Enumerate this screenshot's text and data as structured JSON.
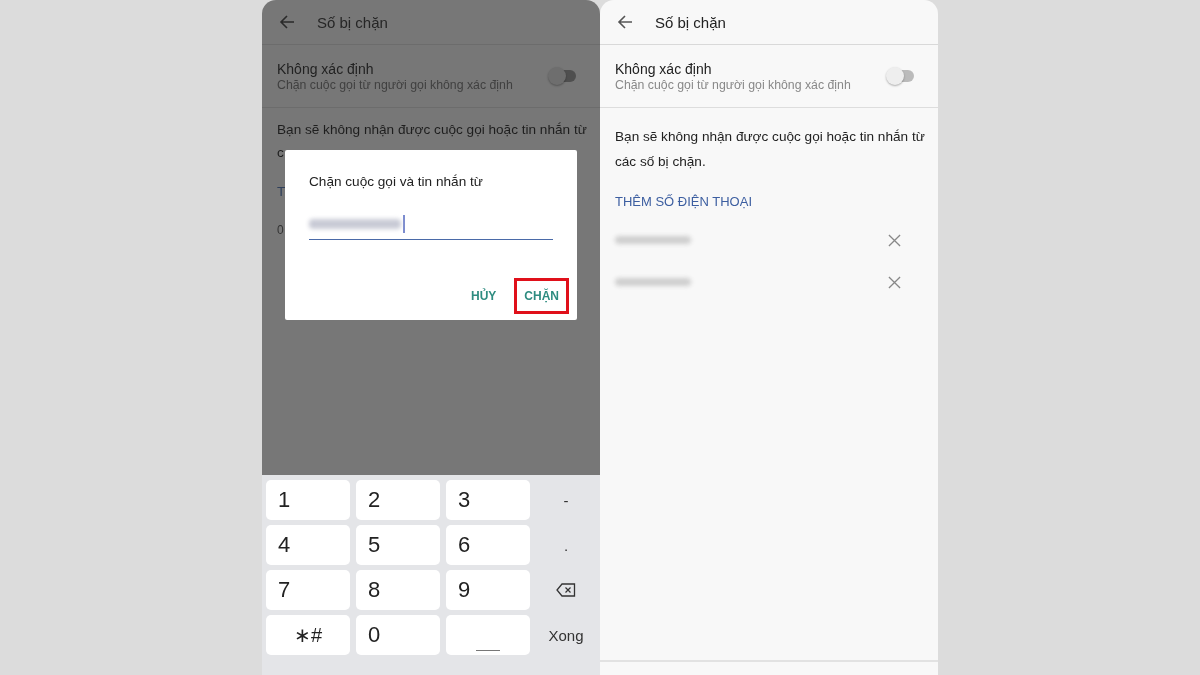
{
  "left_screen": {
    "header": {
      "title": "Số bị chặn"
    },
    "unknown_toggle": {
      "title": "Không xác định",
      "subtitle": "Chặn cuộc gọi từ người gọi không xác định",
      "on": false
    },
    "visible_fragments": [
      "Bạn sẽ không nhận được cuộc gọi hoặc tin nhắn từ",
      "c",
      "T",
      "0"
    ],
    "dialog": {
      "title": "Chặn cuộc gọi và tin nhắn từ",
      "buttons": [
        {
          "label": "HỦY",
          "highlighted": false
        },
        {
          "label": "CHẶN",
          "highlighted": true
        }
      ]
    },
    "keyboard": [
      {
        "kind": "key",
        "label": "1"
      },
      {
        "kind": "key",
        "label": "2"
      },
      {
        "kind": "key",
        "label": "3"
      },
      {
        "kind": "plain",
        "label": "-"
      },
      {
        "kind": "key",
        "label": "4"
      },
      {
        "kind": "key",
        "label": "5"
      },
      {
        "kind": "key",
        "label": "6"
      },
      {
        "kind": "plain",
        "label": "."
      },
      {
        "kind": "key",
        "label": "7"
      },
      {
        "kind": "key",
        "label": "8"
      },
      {
        "kind": "key",
        "label": "9"
      },
      {
        "kind": "backspace"
      },
      {
        "kind": "key",
        "label": "∗#",
        "centered": true
      },
      {
        "kind": "key",
        "label": "0"
      },
      {
        "kind": "space"
      },
      {
        "kind": "plain",
        "label": "Xong"
      }
    ]
  },
  "right_screen": {
    "header": {
      "title": "Số bị chặn"
    },
    "unknown_toggle": {
      "title": "Không xác định",
      "subtitle": "Chặn cuộc gọi từ người gọi không xác định",
      "on": false
    },
    "info": "Bạn sẽ không nhận được cuộc gọi hoặc tin nhắn từ các số bị chặn.",
    "add_link": "THÊM SỐ ĐIỆN THOẠI",
    "blocked_numbers": [
      {
        "kind": "redacted"
      },
      {
        "kind": "redacted"
      }
    ]
  }
}
